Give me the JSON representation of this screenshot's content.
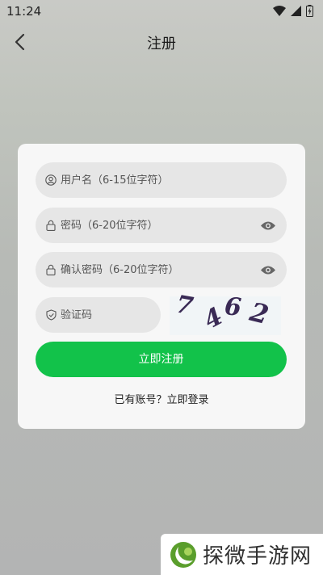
{
  "status_bar": {
    "time": "11:24"
  },
  "header": {
    "title": "注册"
  },
  "form": {
    "username_placeholder": "用户名（6-15位字符）",
    "password_placeholder": "密码（6-20位字符）",
    "confirm_placeholder": "确认密码（6-20位字符）",
    "captcha_placeholder": "验证码",
    "captcha_code": [
      "7",
      "4",
      "6",
      "2"
    ],
    "submit_label": "立即注册",
    "login_prompt": "已有账号？",
    "login_link": "立即登录"
  },
  "watermark": {
    "text": "探微手游网"
  },
  "colors": {
    "accent": "#12c24a",
    "card": "#f7f7f7",
    "field": "#e6e6e6",
    "captcha_text": "#3a2a55"
  }
}
